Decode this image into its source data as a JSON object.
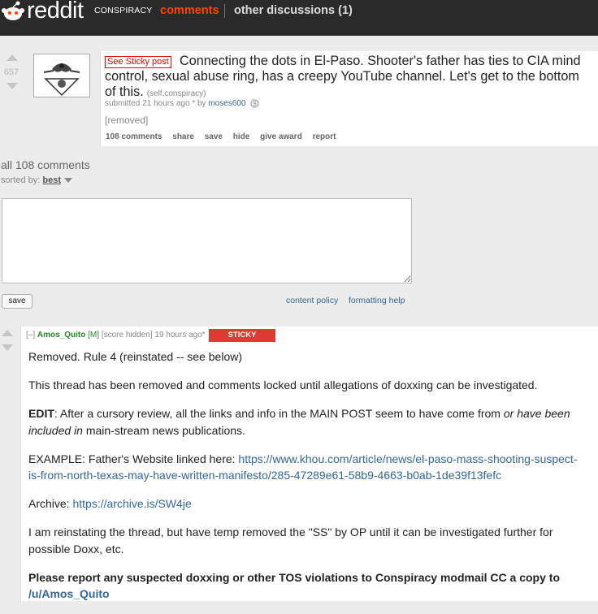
{
  "header": {
    "logo_text": "reddit",
    "subreddit": "CONSPIRACY",
    "tab_comments": "comments",
    "tab_other": "other discussions (1)"
  },
  "post": {
    "score": "657",
    "sticky_label": "See Sticky post",
    "title": "Connecting the dots in El-Paso. Shooter's father has ties to CIA mind control, sexual abuse ring, has a creepy YouTube channel. Let's get to the bottom of this.",
    "domain": "(self.conspiracy)",
    "submitted_prefix": "submitted 21 hours ago * by",
    "author": "moses600",
    "removed": "[removed]",
    "links": [
      "108 comments",
      "share",
      "save",
      "hide",
      "give award",
      "report"
    ]
  },
  "comments_section": {
    "all_comments": "all 108 comments",
    "sorted_label": "sorted by:",
    "sort_value": "best",
    "save_label": "save",
    "content_policy": "content policy",
    "formatting_help": "formatting help"
  },
  "comment": {
    "toggle": "[–]",
    "author": "Amos_Quito",
    "mod": "[M]",
    "meta": "[score hidden] 19 hours ago*",
    "sticky": "STICKY",
    "p1": "Removed. Rule 4 (reinstated -- see below)",
    "p2": "This thread has been removed and comments locked until allegations of doxxing can be investigated.",
    "p3_bold": "EDIT",
    "p3_a": ": After a cursory review, all the links and info in the MAIN POST seem to have come from ",
    "p3_italic1": "or have been included in",
    "p3_b": " main-stream news publications.",
    "p4_prefix": "EXAMPLE: Father's Website linked here: ",
    "p4_link": "https://www.khou.com/article/news/el-paso-mass-shooting-suspect-is-from-north-texas-may-have-written-manifesto/285-47289e61-58b9-4663-b0ab-1de39f13fefc",
    "p5_prefix": "Archive: ",
    "p5_link": "https://archive.is/SW4je",
    "p6": "I am reinstating the thread, but have temp removed the \"SS\" by OP until it can be investigated further for possible Doxx, etc.",
    "p7_bold": "Please report any suspected doxxing or other TOS violations to Conspiracy modmail CC a copy to",
    "p7_link": "/u/Amos_Quito"
  }
}
